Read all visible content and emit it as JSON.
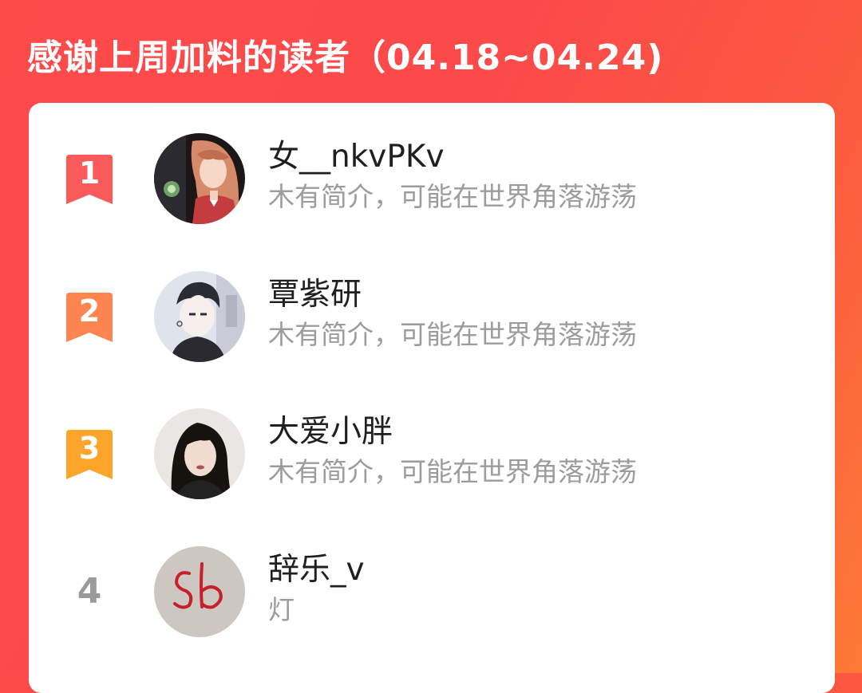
{
  "header": {
    "title": "感谢上周加料的读者（04.18~04.24)"
  },
  "colors": {
    "background_start": "#ff4a4a",
    "background_end": "#fd7a36",
    "rank1": "#fb5a5a",
    "rank2": "#fd8550",
    "rank3": "#fda52b",
    "rank_plain": "#9a9a9a"
  },
  "readers": [
    {
      "rank": "1",
      "name": "女__nkvPKv",
      "bio": "木有简介，可能在世界角落游荡",
      "avatar_icon": "anime-girl-avatar"
    },
    {
      "rank": "2",
      "name": "覃紫研",
      "bio": "木有简介，可能在世界角落游荡",
      "avatar_icon": "anime-boy-avatar"
    },
    {
      "rank": "3",
      "name": "大爱小胖",
      "bio": "木有简介，可能在世界角落游荡",
      "avatar_icon": "woman-photo-avatar"
    },
    {
      "rank": "4",
      "name": "辞乐_v",
      "bio": "灯",
      "avatar_icon": "handwriting-avatar"
    }
  ]
}
